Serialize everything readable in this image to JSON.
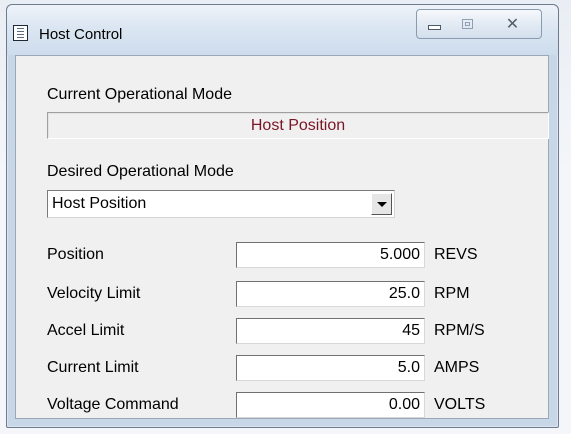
{
  "window": {
    "title": "Host Control",
    "min_icon": "minimize-icon",
    "max_icon": "maximize-icon",
    "close_icon": "close-icon",
    "close_glyph": "☒"
  },
  "current_mode": {
    "label": "Current Operational Mode",
    "value": "Host Position",
    "value_color": "#7b1626"
  },
  "desired_mode": {
    "label": "Desired Operational Mode",
    "selected": "Host Position"
  },
  "fields": [
    {
      "label": "Position",
      "value": "5.000",
      "unit": "REVS"
    },
    {
      "label": "Velocity Limit",
      "value": "25.0",
      "unit": "RPM"
    },
    {
      "label": "Accel Limit",
      "value": "45",
      "unit": "RPM/S"
    },
    {
      "label": "Current Limit",
      "value": "5.0",
      "unit": "AMPS"
    },
    {
      "label": "Voltage Command",
      "value": "0.00",
      "unit": "VOLTS"
    }
  ]
}
